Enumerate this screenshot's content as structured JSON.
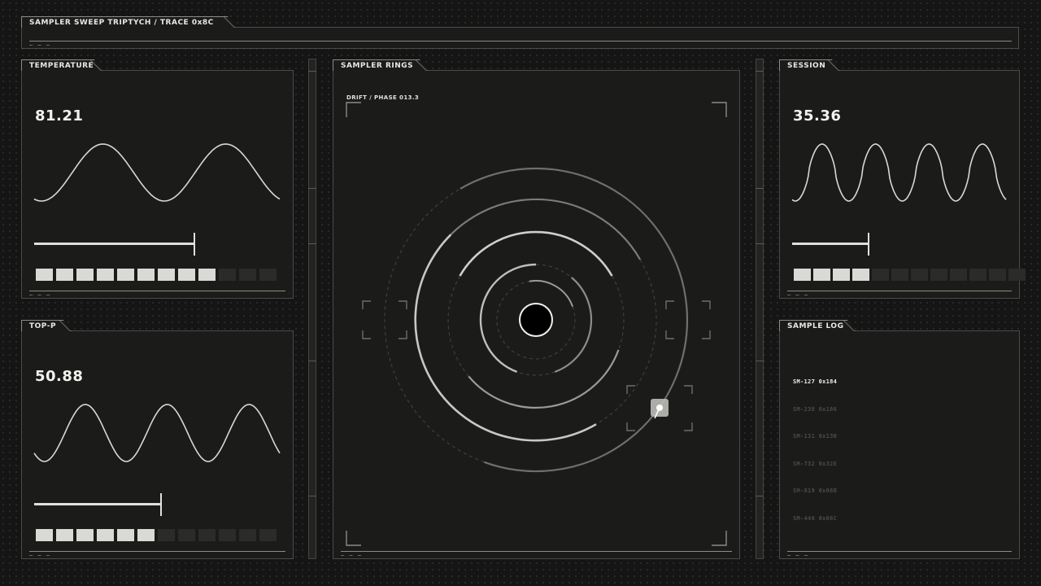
{
  "header": {
    "title": "SAMPLER SWEEP TRIPTYCH / TRACE 0x8C",
    "dashes": "— — —"
  },
  "panels": {
    "temperature": {
      "label": "TEMPERATURE",
      "value": "81.21",
      "slider_fraction": 0.8,
      "segments_on": 9,
      "segments_total": 12,
      "dashes": "— — —"
    },
    "top_p": {
      "label": "TOP-P",
      "value": "50.88",
      "slider_fraction": 0.51,
      "segments_on": 6,
      "segments_total": 12,
      "dashes": "— — —"
    },
    "session": {
      "label": "SESSION",
      "value": "35.36",
      "slider_fraction": 0.35,
      "segments_on": 4,
      "segments_total": 12,
      "dashes": "— — —"
    },
    "sampler_rings": {
      "label": "SAMPLER RINGS",
      "sub_label": "DRIFT / PHASE 013.3",
      "dashes": "— — —"
    },
    "sample_log": {
      "label": "SAMPLE LOG",
      "dashes": "— — —",
      "entries": [
        {
          "text": "SM-127 0x184",
          "active": true
        },
        {
          "text": "SM-238 0x186",
          "active": false
        },
        {
          "text": "SM-131 0x13B",
          "active": false
        },
        {
          "text": "SM-732 0x32E",
          "active": false
        },
        {
          "text": "SM-819 0x06B",
          "active": false
        },
        {
          "text": "SM-446 0x06C",
          "active": false
        }
      ]
    }
  },
  "colors": {
    "background": "#141514",
    "panel": "#1b1c1a",
    "accent": "#e6e6e2",
    "dim": "#2b2c2a"
  }
}
